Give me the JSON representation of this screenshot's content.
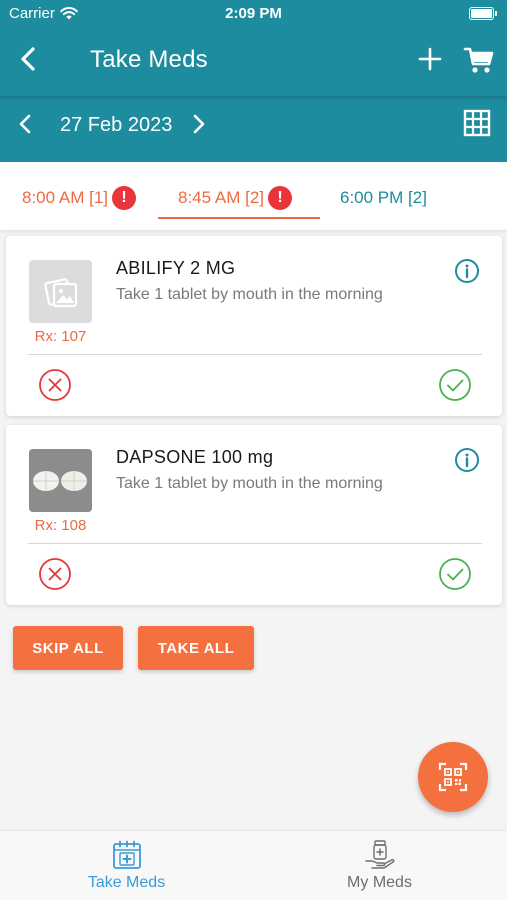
{
  "status_bar": {
    "carrier": "Carrier",
    "time": "2:09 PM"
  },
  "header": {
    "title": "Take Meds",
    "back_icon": "chevron-left-icon",
    "add_icon": "plus-icon",
    "cart_icon": "cart-icon"
  },
  "date_nav": {
    "date": "27 Feb 2023",
    "calendar_icon": "grid-icon"
  },
  "tabs": [
    {
      "label": "8:00 AM [1]",
      "alert": "!",
      "state": "missed"
    },
    {
      "label": "8:45 AM [2]",
      "alert": "!",
      "state": "selected"
    },
    {
      "label": "6:00 PM [2]",
      "alert": "",
      "state": "upcoming"
    }
  ],
  "medications": [
    {
      "name": "ABILIFY 2 MG",
      "instructions": "Take 1 tablet by mouth in the morning",
      "rx": "Rx: 107",
      "image": "placeholder-image-icon"
    },
    {
      "name": "DAPSONE 100 mg",
      "instructions": "Take 1 tablet by mouth in the morning",
      "rx": "Rx: 108",
      "image": "pill-photo"
    }
  ],
  "actions": {
    "skip_all": "SKIP ALL",
    "take_all": "TAKE ALL"
  },
  "fab": {
    "icon": "qr-scan-icon"
  },
  "bottom_nav": [
    {
      "label": "Take Meds",
      "icon": "calendar-plus-icon",
      "active": true
    },
    {
      "label": "My Meds",
      "icon": "hand-medicine-icon",
      "active": false
    }
  ],
  "colors": {
    "primary": "#1d8c9e",
    "accent": "#f4703e",
    "alert": "#e7353a",
    "success": "#4caf50",
    "active_nav": "#3b9bd8"
  }
}
